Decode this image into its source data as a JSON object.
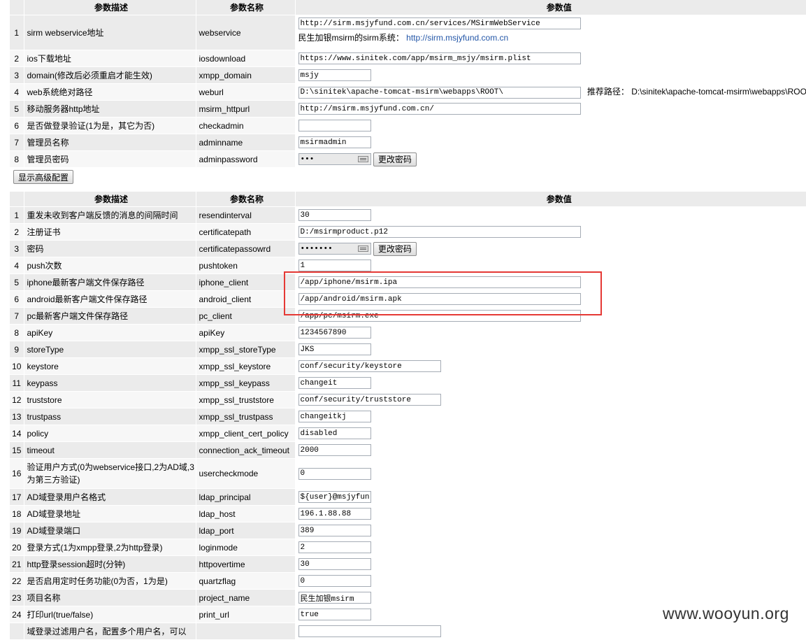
{
  "headers": {
    "desc": "参数描述",
    "name": "参数名称",
    "value": "参数值"
  },
  "table1": [
    {
      "num": "1",
      "desc": "sirm webservice地址",
      "name": "webservice",
      "value": "http://sirm.msjyfund.com.cn/services/MSirmWebService",
      "note_label": "民生加银msirm的sirm系统：",
      "note_link": "http://sirm.msjyfund.com.cn"
    },
    {
      "num": "2",
      "desc": "ios下载地址",
      "name": "iosdownload",
      "value": "https://www.sinitek.com/app/msirm_msjy/msirm.plist"
    },
    {
      "num": "3",
      "desc": "domain(修改后必须重启才能生效)",
      "name": "xmpp_domain",
      "value": "msjy"
    },
    {
      "num": "4",
      "desc": "web系统绝对路径",
      "name": "weburl",
      "value": "D:\\sinitek\\apache-tomcat-msirm\\webapps\\ROOT\\",
      "hint_label": "推荐路径：",
      "hint_value": "D:\\sinitek\\apache-tomcat-msirm\\webapps\\ROOT"
    },
    {
      "num": "5",
      "desc": "移动服务器http地址",
      "name": "msirm_httpurl",
      "value": "http://msirm.msjyfund.com.cn/"
    },
    {
      "num": "6",
      "desc": "是否做登录验证(1为是，其它为否)",
      "name": "checkadmin",
      "value": ""
    },
    {
      "num": "7",
      "desc": "管理员名称",
      "name": "adminname",
      "value": "msirmadmin"
    },
    {
      "num": "8",
      "desc": "管理员密码",
      "name": "adminpassword",
      "value": "•••",
      "button": "更改密码"
    }
  ],
  "advanced_button": "显示高级配置",
  "table2": [
    {
      "num": "1",
      "desc": "重发未收到客户端反馈的消息的间隔时间",
      "name": "resendinterval",
      "value": "30"
    },
    {
      "num": "2",
      "desc": "注册证书",
      "name": "certificatepath",
      "value": "D:/msirmproduct.p12"
    },
    {
      "num": "3",
      "desc": "密码",
      "name": "certificatepassowrd",
      "value": "•••••••",
      "button": "更改密码"
    },
    {
      "num": "4",
      "desc": "push次数",
      "name": "pushtoken",
      "value": "1"
    },
    {
      "num": "5",
      "desc": "iphone最新客户端文件保存路径",
      "name": "iphone_client",
      "value": "/app/iphone/msirm.ipa"
    },
    {
      "num": "6",
      "desc": "android最新客户端文件保存路径",
      "name": "android_client",
      "value": "/app/android/msirm.apk"
    },
    {
      "num": "7",
      "desc": "pc最新客户端文件保存路径",
      "name": "pc_client",
      "value": "/app/pc/msirm.exe"
    },
    {
      "num": "8",
      "desc": "apiKey",
      "name": "apiKey",
      "value": "1234567890"
    },
    {
      "num": "9",
      "desc": "storeType",
      "name": "xmpp_ssl_storeType",
      "value": "JKS"
    },
    {
      "num": "10",
      "desc": "keystore",
      "name": "xmpp_ssl_keystore",
      "value": "conf/security/keystore"
    },
    {
      "num": "11",
      "desc": "keypass",
      "name": "xmpp_ssl_keypass",
      "value": "changeit"
    },
    {
      "num": "12",
      "desc": "truststore",
      "name": "xmpp_ssl_truststore",
      "value": "conf/security/truststore"
    },
    {
      "num": "13",
      "desc": "trustpass",
      "name": "xmpp_ssl_trustpass",
      "value": "changeitkj"
    },
    {
      "num": "14",
      "desc": "policy",
      "name": "xmpp_client_cert_policy",
      "value": "disabled"
    },
    {
      "num": "15",
      "desc": "timeout",
      "name": "connection_ack_timeout",
      "value": "2000"
    },
    {
      "num": "16",
      "desc": "验证用户方式(0为webservice接口,2为AD域,3为第三方验证)",
      "name": "usercheckmode",
      "value": "0"
    },
    {
      "num": "17",
      "desc": "AD域登录用户名格式",
      "name": "ldap_principal",
      "value": "${user}@msjyfund."
    },
    {
      "num": "18",
      "desc": "AD域登录地址",
      "name": "ldap_host",
      "value": "196.1.88.88"
    },
    {
      "num": "19",
      "desc": "AD域登录端口",
      "name": "ldap_port",
      "value": "389"
    },
    {
      "num": "20",
      "desc": "登录方式(1为xmpp登录,2为http登录)",
      "name": "loginmode",
      "value": "2"
    },
    {
      "num": "21",
      "desc": "http登录session超时(分钟)",
      "name": "httpovertime",
      "value": "30"
    },
    {
      "num": "22",
      "desc": "是否启用定时任务功能(0为否，1为是)",
      "name": "quartzflag",
      "value": "0"
    },
    {
      "num": "23",
      "desc": "项目名称",
      "name": "project_name",
      "value": "民生加银msirm"
    },
    {
      "num": "24",
      "desc": "打印url(true/false)",
      "name": "print_url",
      "value": "true"
    },
    {
      "num": "",
      "desc": "域登录过滤用户名，配置多个用户名，可以",
      "name": "",
      "value": ""
    }
  ],
  "watermark": "www.wooyun.org",
  "colors": {
    "row_odd": "#ebebeb",
    "row_even": "#f7f7f7",
    "highlight_box": "#e53935",
    "link": "#2457a8"
  }
}
